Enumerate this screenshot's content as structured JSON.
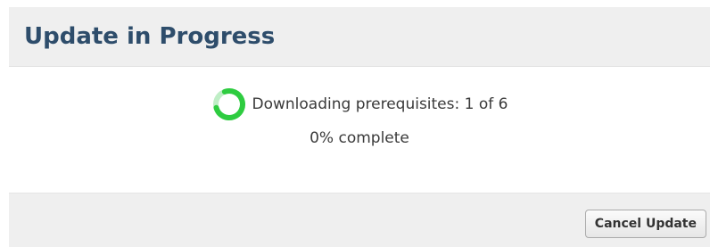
{
  "dialog": {
    "title": "Update in Progress",
    "status": {
      "text": "Downloading prerequisites: 1 of 6",
      "percent_text": "0% complete",
      "progress_fraction": 0.0,
      "spinner_icon": "loading-spinner-icon",
      "spinner_color": "#2ecc40"
    },
    "footer": {
      "cancel_label": "Cancel Update"
    }
  },
  "colors": {
    "title": "#2e4d6b",
    "header_bg": "#efefef",
    "footer_bg": "#efefef",
    "text": "#3a3a3a"
  }
}
